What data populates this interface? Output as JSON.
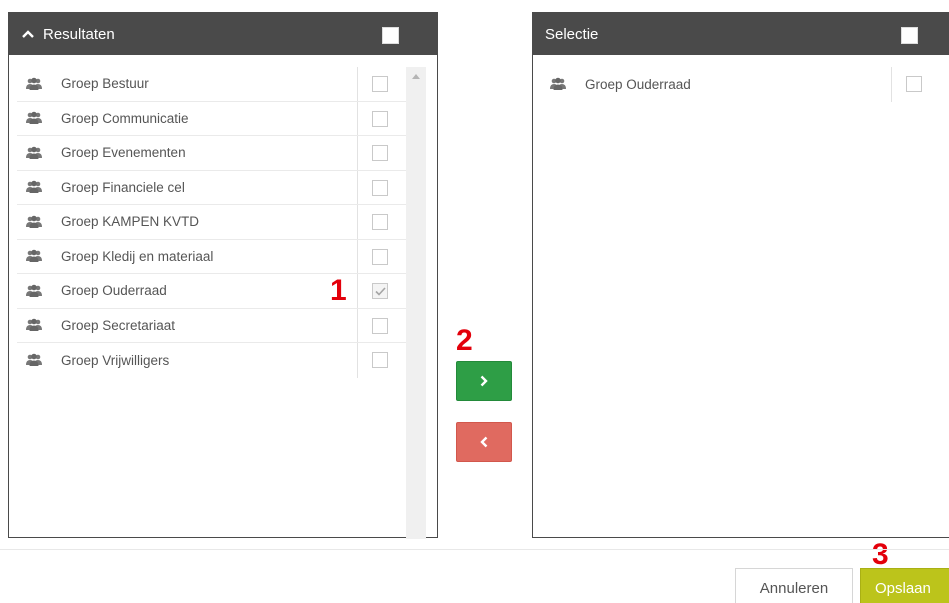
{
  "results_panel": {
    "title": "Resultaten",
    "items": [
      {
        "label": "Groep Bestuur",
        "checked": false
      },
      {
        "label": "Groep Communicatie",
        "checked": false
      },
      {
        "label": "Groep Evenementen",
        "checked": false
      },
      {
        "label": "Groep Financiele cel",
        "checked": false
      },
      {
        "label": "Groep KAMPEN KVTD",
        "checked": false
      },
      {
        "label": "Groep Kledij en materiaal",
        "checked": false
      },
      {
        "label": "Groep Ouderraad",
        "checked": true
      },
      {
        "label": "Groep Secretariaat",
        "checked": false
      },
      {
        "label": "Groep Vrijwilligers",
        "checked": false
      }
    ]
  },
  "selection_panel": {
    "title": "Selectie",
    "items": [
      {
        "label": "Groep Ouderraad",
        "checked": false
      }
    ]
  },
  "move_buttons": {
    "add_icon": "chevron-right-icon",
    "remove_icon": "chevron-left-icon"
  },
  "annotations": {
    "step1": "1",
    "step2": "2",
    "step3": "3"
  },
  "footer": {
    "cancel_label": "Annuleren",
    "save_label": "Opslaan"
  },
  "colors": {
    "header_bg": "#4a4a4a",
    "add_button": "#2e9e46",
    "remove_button": "#e06a60",
    "save_button": "#bcc41b",
    "annotation": "#e3000b"
  }
}
